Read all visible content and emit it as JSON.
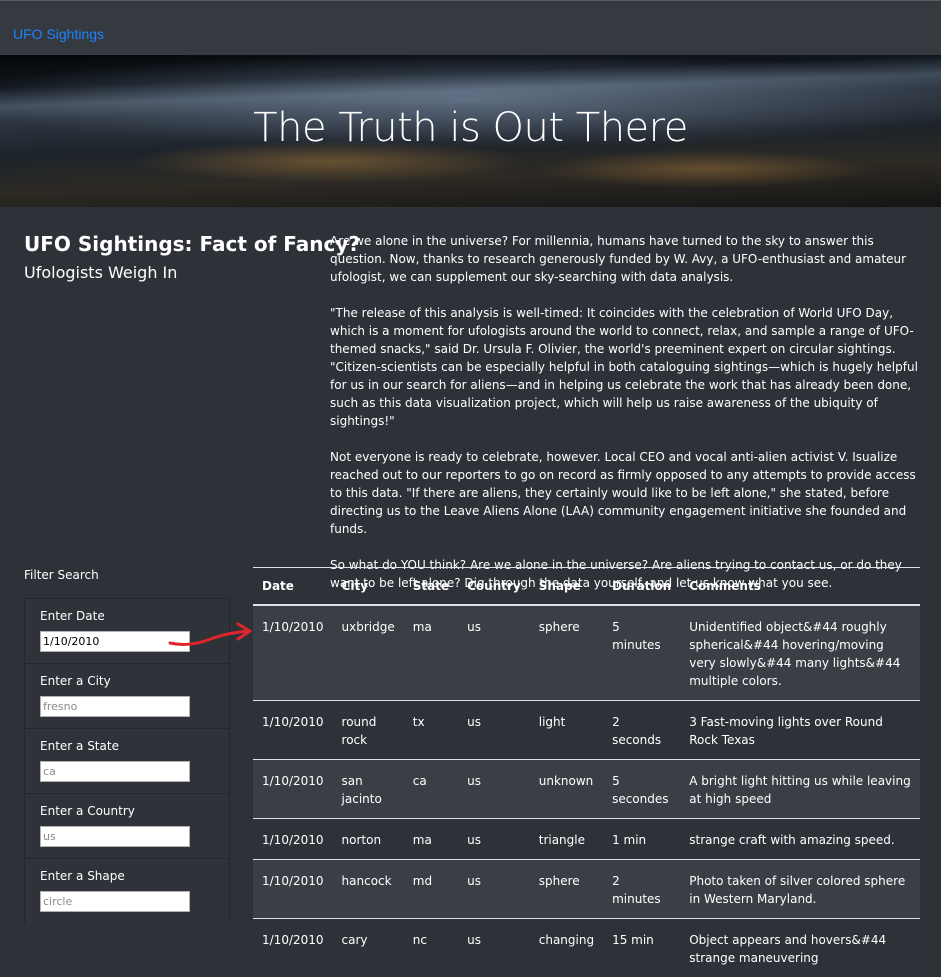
{
  "navbar": {
    "brand": "UFO Sightings"
  },
  "hero": {
    "title": "The Truth is Out There"
  },
  "article": {
    "heading": "UFO Sightings: Fact of Fancy?",
    "subheading": "Ufologists Weigh In",
    "paragraphs": [
      "Are we alone in the universe? For millennia, humans have turned to the sky to answer this question. Now, thanks to research generously funded by W. Avy, a UFO-enthusiast and amateur ufologist, we can supplement our sky-searching with data analysis.",
      "\"The release of this analysis is well-timed: It coincides with the celebration of World UFO Day, which is a moment for ufologists around the world to connect, relax, and sample a range of UFO-themed snacks,\" said Dr. Ursula F. Olivier, the world's preeminent expert on circular sightings. \"Citizen-scientists can be especially helpful in both cataloguing sightings—which is hugely helpful for us in our search for aliens—and in helping us celebrate the work that has already been done, such as this data visualization project, which will help us raise awareness of the ubiquity of sightings!\"",
      "Not everyone is ready to celebrate, however. Local CEO and vocal anti-alien activist V. Isualize reached out to our reporters to go on record as firmly opposed to any attempts to provide access to this data. \"If there are aliens, they certainly would like to be left alone,\" she stated, before directing us to the Leave Aliens Alone (LAA) community engagement initiative she founded and funds.",
      "So what do YOU think? Are we alone in the universe? Are aliens trying to contact us, or do they want to be left alone? Dig through the data yourself, and let us know what you see."
    ]
  },
  "filters": {
    "title": "Filter Search",
    "items": [
      {
        "label": "Enter Date",
        "value": "1/10/2010",
        "placeholder": ""
      },
      {
        "label": "Enter a City",
        "value": "",
        "placeholder": "fresno"
      },
      {
        "label": "Enter a State",
        "value": "",
        "placeholder": "ca"
      },
      {
        "label": "Enter a Country",
        "value": "",
        "placeholder": "us"
      },
      {
        "label": "Enter a Shape",
        "value": "",
        "placeholder": "circle"
      }
    ]
  },
  "table": {
    "headers": [
      "Date",
      "City",
      "State",
      "Country",
      "Shape",
      "Duration",
      "Comments"
    ],
    "rows": [
      [
        "1/10/2010",
        "uxbridge",
        "ma",
        "us",
        "sphere",
        "5 minutes",
        "Unidentified object&#44 roughly spherical&#44 hovering/moving very slowly&#44 many lights&#44 multiple colors."
      ],
      [
        "1/10/2010",
        "round rock",
        "tx",
        "us",
        "light",
        "2 seconds",
        "3 Fast-moving lights over Round Rock Texas"
      ],
      [
        "1/10/2010",
        "san jacinto",
        "ca",
        "us",
        "unknown",
        "5 secondes",
        "A bright light hitting us while leaving at high speed"
      ],
      [
        "1/10/2010",
        "norton",
        "ma",
        "us",
        "triangle",
        "1 min",
        "strange craft with amazing speed."
      ],
      [
        "1/10/2010",
        "hancock",
        "md",
        "us",
        "sphere",
        "2 minutes",
        "Photo taken of silver colored sphere in Western Maryland."
      ],
      [
        "1/10/2010",
        "cary",
        "nc",
        "us",
        "changing",
        "15 min",
        "Object appears and hovers&#44 strange maneuvering"
      ]
    ]
  },
  "colors": {
    "background": "#2e3238",
    "navbar": "#343a40",
    "brand_link": "#1e84ff",
    "annotation_arrow": "#e0262b"
  }
}
